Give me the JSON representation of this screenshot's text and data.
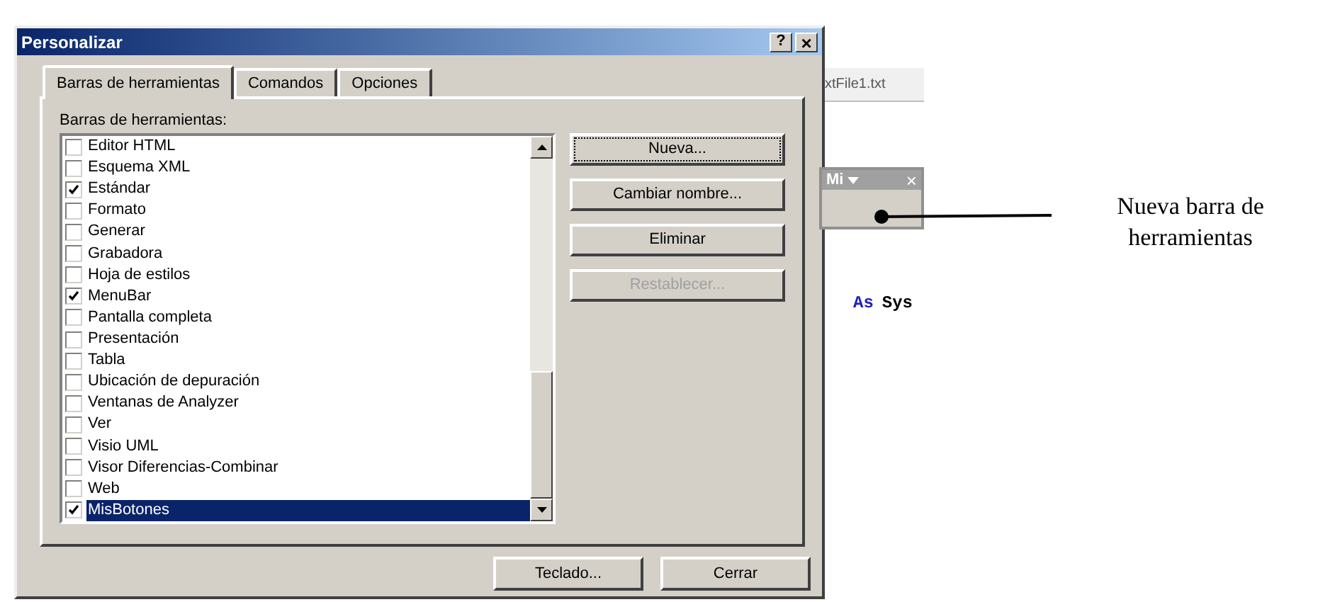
{
  "editor": {
    "file_tab": "xtFile1.txt",
    "code": [
      {
        "text": "As",
        "kind": "keyword"
      },
      {
        "text": "Sys",
        "kind": "plain"
      }
    ]
  },
  "dialog": {
    "title": "Personalizar",
    "help_button": "?",
    "close_button": "×",
    "tabs": [
      {
        "label": "Barras de herramientas",
        "selected": true
      },
      {
        "label": "Comandos",
        "selected": false
      },
      {
        "label": "Opciones",
        "selected": false
      }
    ],
    "list_label": "Barras de herramientas:",
    "toolbars": [
      {
        "label": "Editor HTML",
        "checked": false,
        "selected": false
      },
      {
        "label": "Esquema XML",
        "checked": false,
        "selected": false
      },
      {
        "label": "Estándar",
        "checked": true,
        "selected": false
      },
      {
        "label": "Formato",
        "checked": false,
        "selected": false
      },
      {
        "label": "Generar",
        "checked": false,
        "selected": false
      },
      {
        "label": "Grabadora",
        "checked": false,
        "selected": false
      },
      {
        "label": "Hoja de estilos",
        "checked": false,
        "selected": false
      },
      {
        "label": "MenuBar",
        "checked": true,
        "selected": false
      },
      {
        "label": "Pantalla completa",
        "checked": false,
        "selected": false
      },
      {
        "label": "Presentación",
        "checked": false,
        "selected": false
      },
      {
        "label": "Tabla",
        "checked": false,
        "selected": false
      },
      {
        "label": "Ubicación de depuración",
        "checked": false,
        "selected": false
      },
      {
        "label": "Ventanas de Analyzer",
        "checked": false,
        "selected": false
      },
      {
        "label": "Ver",
        "checked": false,
        "selected": false
      },
      {
        "label": "Visio UML",
        "checked": false,
        "selected": false
      },
      {
        "label": "Visor Diferencias-Combinar",
        "checked": false,
        "selected": false
      },
      {
        "label": "Web",
        "checked": false,
        "selected": false
      },
      {
        "label": "MisBotones",
        "checked": true,
        "selected": true
      }
    ],
    "side_buttons": [
      {
        "label": "Nueva...",
        "disabled": false,
        "focused": true
      },
      {
        "label": "Cambiar nombre...",
        "disabled": false,
        "focused": false
      },
      {
        "label": "Eliminar",
        "disabled": false,
        "focused": false
      },
      {
        "label": "Restablecer...",
        "disabled": true,
        "focused": false
      }
    ],
    "footer_buttons": [
      "Teclado...",
      "Cerrar"
    ]
  },
  "mini_toolbar": {
    "title": "Mi",
    "close_button": "×"
  },
  "annotation": "Nueva barra de herramientas"
}
